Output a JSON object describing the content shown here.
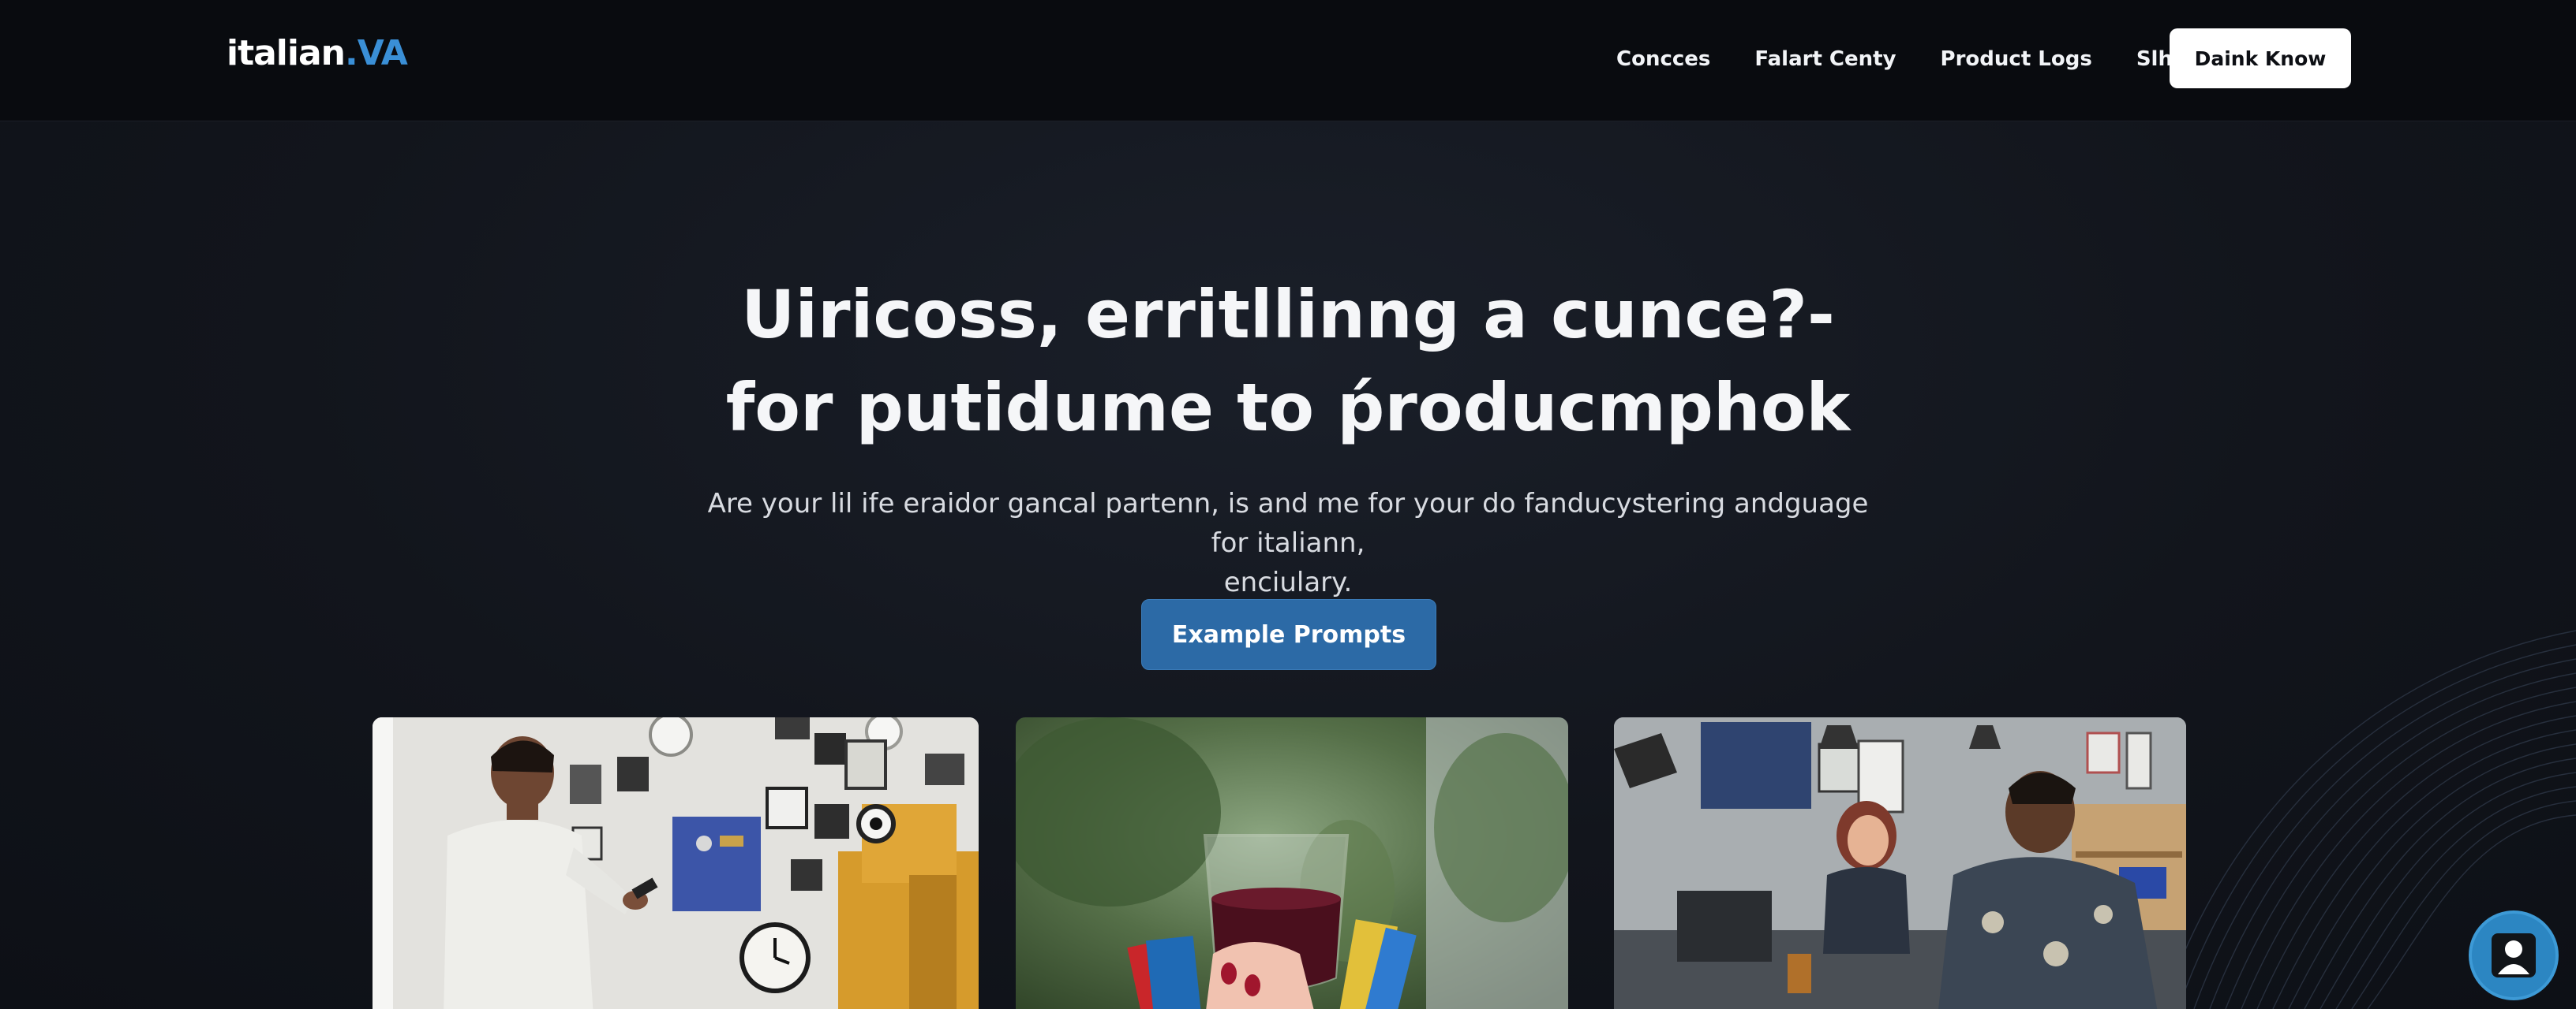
{
  "brand": {
    "name_main": "italian",
    "name_accent": ".VA",
    "accent_color": "#3a8fd6"
  },
  "nav": {
    "links": [
      "Concces",
      "Falart Centy",
      "Product Logs",
      "Slhip"
    ],
    "cta_label": "Daink Know"
  },
  "hero": {
    "title_line1": "Uiricoss, erritllinng a cunce?-",
    "title_line2": "for  putidume to ṕroducmphok",
    "subtitle_line1": "Are your lil ife eraidor gancal partenn, is and me for your do fanducystering andguage for italiann,",
    "subtitle_line2": "enciulary.",
    "button_label": "Example Prompts",
    "button_color": "#2c6aa6"
  },
  "cards": [
    {
      "icon": "workshop-photo"
    },
    {
      "icon": "wine-glass-photo"
    },
    {
      "icon": "office-meeting-photo"
    }
  ],
  "chat_widget": {
    "icon": "user-avatar-icon",
    "color": "#2c86c2"
  }
}
